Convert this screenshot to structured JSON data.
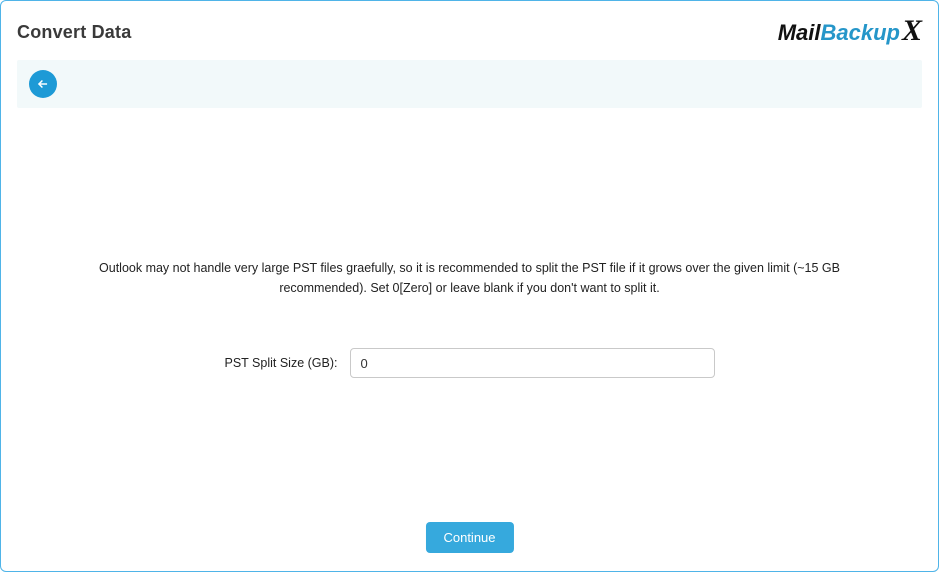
{
  "header": {
    "title": "Convert Data",
    "logo": {
      "mail": "Mail",
      "backup": "Backup",
      "x": "X"
    }
  },
  "back": {
    "icon": "arrow-left"
  },
  "main": {
    "description": "Outlook may not handle very large PST files graefully, so it is recommended to split the PST file if it grows over the given limit (~15 GB recommended). Set 0[Zero] or leave blank if you don't want to split it.",
    "field_label": "PST Split Size (GB):",
    "field_value": "0"
  },
  "footer": {
    "continue_label": "Continue"
  }
}
